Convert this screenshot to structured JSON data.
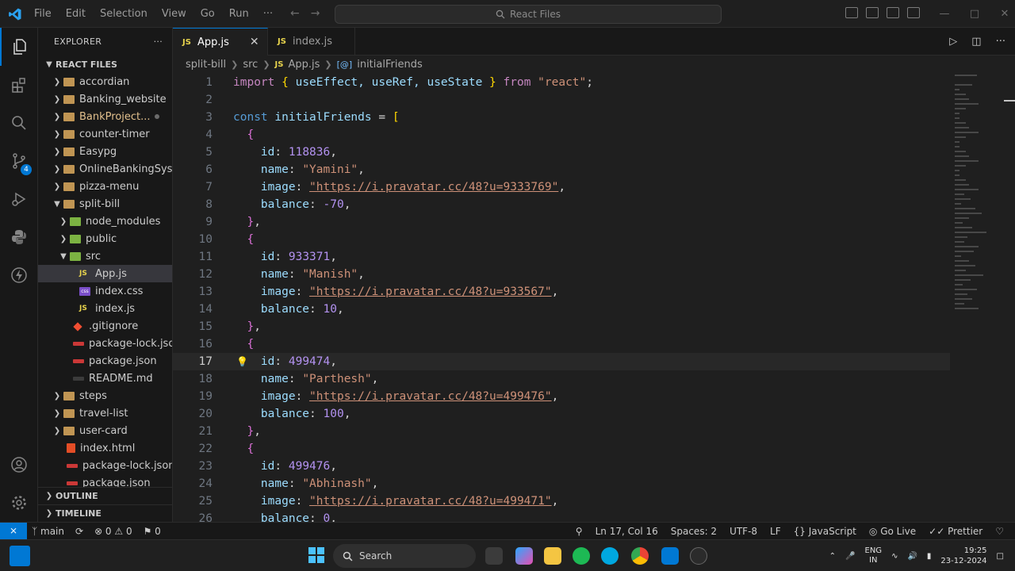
{
  "titlebar": {
    "menu": [
      "File",
      "Edit",
      "Selection",
      "View",
      "Go",
      "Run",
      "···"
    ],
    "search_text": "React Files"
  },
  "activity": {
    "source_control_badge": "4"
  },
  "sidebar": {
    "title": "EXPLORER",
    "more": "···",
    "section": "REACT FILES",
    "items": [
      {
        "label": "accordian"
      },
      {
        "label": "Banking_website"
      },
      {
        "label": "BankProject..."
      },
      {
        "label": "counter-timer"
      },
      {
        "label": "Easypg"
      },
      {
        "label": "OnlineBankingSys..."
      },
      {
        "label": "pizza-menu"
      },
      {
        "label": "split-bill"
      },
      {
        "label": "node_modules"
      },
      {
        "label": "public"
      },
      {
        "label": "src"
      },
      {
        "label": "App.js"
      },
      {
        "label": "index.css"
      },
      {
        "label": "index.js"
      },
      {
        "label": ".gitignore"
      },
      {
        "label": "package-lock.json"
      },
      {
        "label": "package.json"
      },
      {
        "label": "README.md"
      },
      {
        "label": "steps"
      },
      {
        "label": "travel-list"
      },
      {
        "label": "user-card"
      },
      {
        "label": "index.html"
      },
      {
        "label": "package-lock.json"
      },
      {
        "label": "package.json"
      }
    ],
    "outline": "OUTLINE",
    "timeline": "TIMELINE"
  },
  "tabs": [
    {
      "badge": "JS",
      "label": "App.js",
      "close": "✕"
    },
    {
      "badge": "JS",
      "label": "index.js"
    }
  ],
  "breadcrumb": {
    "parts": [
      "split-bill",
      "src",
      "App.js",
      "initialFriends"
    ],
    "js_badge": "JS"
  },
  "editor": {
    "line_numbers": [
      "1",
      "2",
      "3",
      "4",
      "5",
      "6",
      "7",
      "8",
      "9",
      "10",
      "11",
      "12",
      "13",
      "14",
      "15",
      "16",
      "17",
      "18",
      "19",
      "20",
      "21",
      "22",
      "23",
      "24",
      "25",
      "26"
    ],
    "friends": [
      {
        "id": "118836",
        "name": "\"Yamini\"",
        "image": "\"https://i.pravatar.cc/48?u=9333769\"",
        "balance": "-70"
      },
      {
        "id": "933371",
        "name": "\"Manish\"",
        "image": "\"https://i.pravatar.cc/48?u=933567\"",
        "balance": "10"
      },
      {
        "id": "499474",
        "name": "\"Parthesh\"",
        "image": "\"https://i.pravatar.cc/48?u=499476\"",
        "balance": "100"
      },
      {
        "id": "499476",
        "name": "\"Abhinash\"",
        "image": "\"https://i.pravatar.cc/48?u=499471\"",
        "balance": "0"
      }
    ],
    "import_line": {
      "kw": "import",
      "names": "useEffect, useRef, useState",
      "from": "from",
      "module": "\"react\""
    },
    "const_line": {
      "kw": "const",
      "name": "initialFriends"
    }
  },
  "statusbar": {
    "branch": "main",
    "errors": "⊗ 0 ⚠ 0",
    "ports": "⚑ 0",
    "position": "Ln 17, Col 16",
    "spaces": "Spaces: 2",
    "encoding": "UTF-8",
    "eol": "LF",
    "language": "JavaScript",
    "golive": "Go Live",
    "prettier": "Prettier"
  },
  "taskbar": {
    "search": "Search",
    "lang_top": "ENG",
    "lang_bottom": "IN",
    "time": "19:25",
    "date": "23-12-2024"
  },
  "colors": {
    "accent": "#0078d4",
    "folder": "#c09553",
    "js": "#e8d44d"
  }
}
